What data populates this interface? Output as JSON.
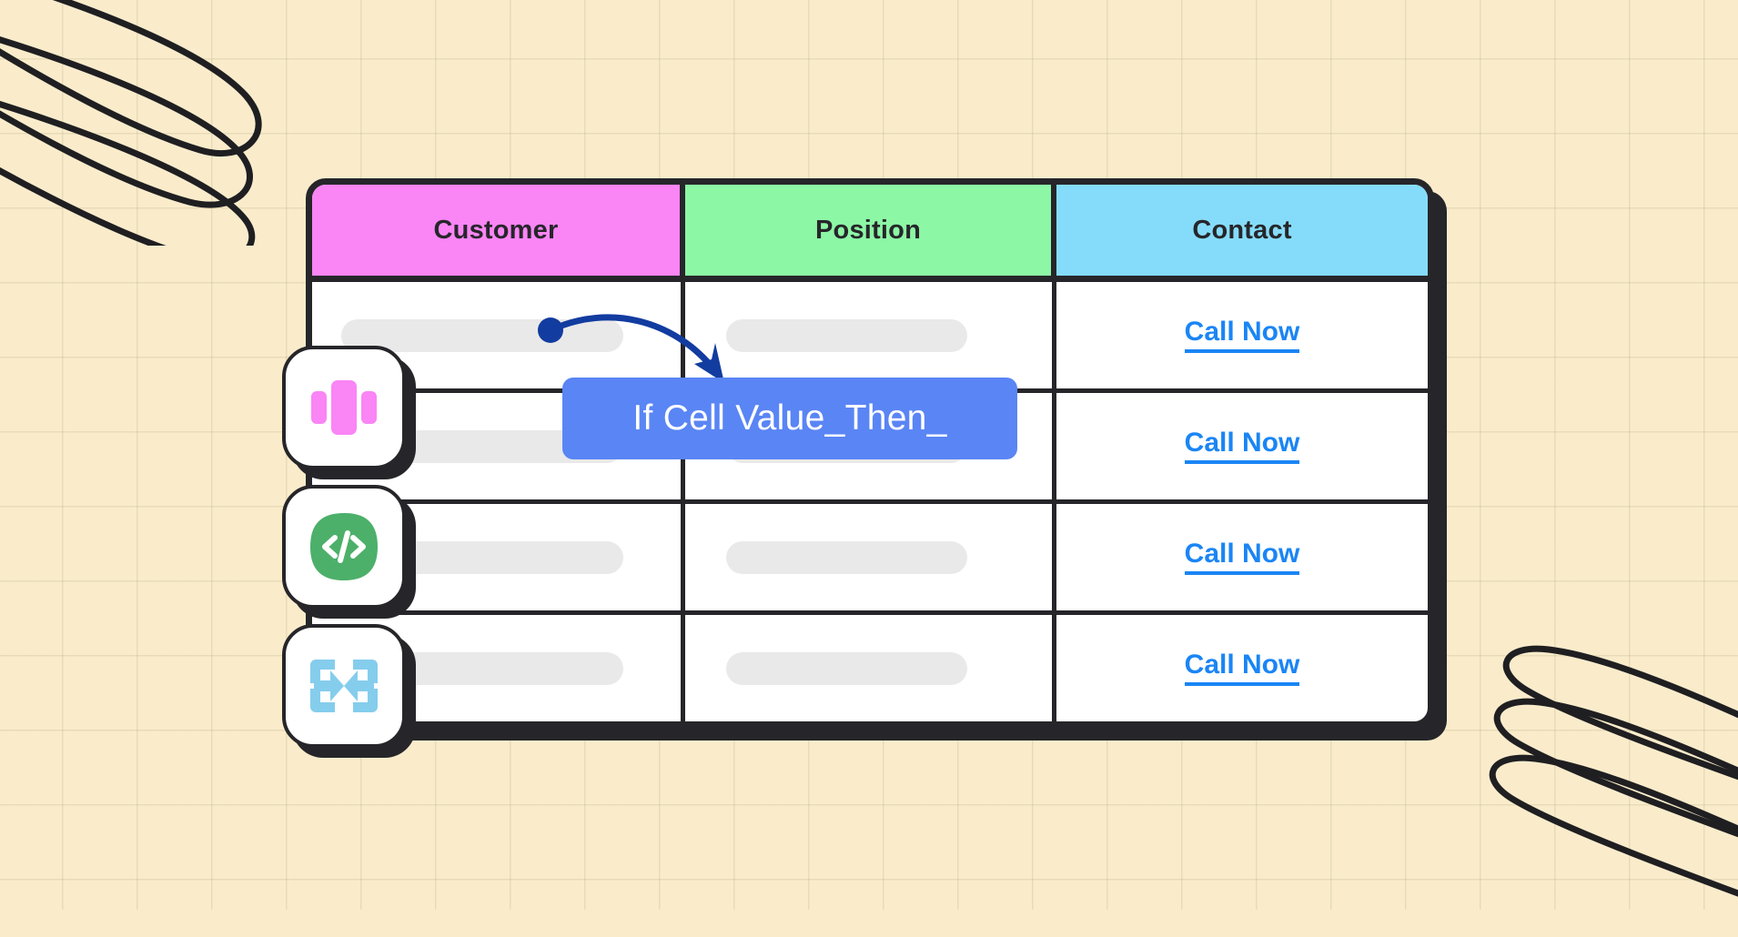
{
  "background": {
    "color": "#faeccb",
    "grid_line_color": "#bcb48c",
    "doodle_color": "#1f1f22",
    "doodles": [
      "scribble-loops-top-left",
      "scribble-loops-bottom-right"
    ]
  },
  "table": {
    "border_color": "#26262a",
    "headers": [
      {
        "label": "Customer",
        "color": "#fa85f5"
      },
      {
        "label": "Position",
        "color": "#8cf7a5"
      },
      {
        "label": "Contact",
        "color": "#85dcfa"
      }
    ],
    "rows": [
      {
        "customer": "",
        "position": "",
        "contact_label": "Call Now"
      },
      {
        "customer": "",
        "position": "",
        "contact_label": "Call Now"
      },
      {
        "customer": "",
        "position": "",
        "contact_label": "Call Now"
      },
      {
        "customer": "",
        "position": "",
        "contact_label": "Call Now"
      }
    ],
    "link_color": "#1a85f5",
    "placeholder_color": "#e9e9e9"
  },
  "tooltip": {
    "text": "If Cell Value_Then_",
    "background": "#5a85f5",
    "text_color": "#ffffff"
  },
  "annotation": {
    "arrow_color": "#123ca0",
    "from": "customer-cell-row-1",
    "to": "position-cell-row-1"
  },
  "badges": [
    {
      "name": "carousel-icon",
      "color": "#fa85f5"
    },
    {
      "name": "code-icon",
      "color": "#4cb06a"
    },
    {
      "name": "compress-icon",
      "color": "#85cdec"
    }
  ]
}
